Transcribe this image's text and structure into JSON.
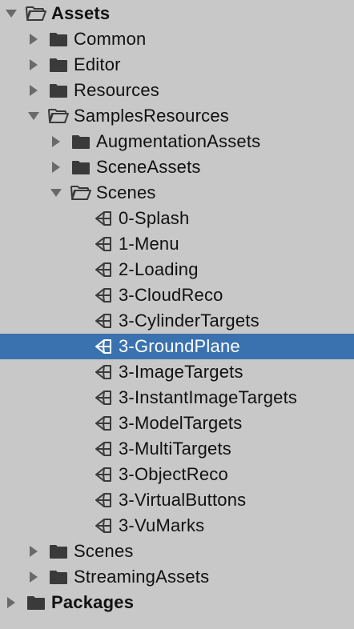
{
  "project_tree": {
    "colors": {
      "background": "#c8c8c8",
      "selection": "#3a72b0",
      "text": "#111111",
      "text_selected": "#ffffff",
      "icon": "#3a3a3a"
    },
    "items": [
      {
        "label": "Assets",
        "depth": 0,
        "type": "folder",
        "expanded": true,
        "bold": true
      },
      {
        "label": "Common",
        "depth": 1,
        "type": "folder",
        "expanded": false
      },
      {
        "label": "Editor",
        "depth": 1,
        "type": "folder",
        "expanded": false
      },
      {
        "label": "Resources",
        "depth": 1,
        "type": "folder",
        "expanded": false
      },
      {
        "label": "SamplesResources",
        "depth": 1,
        "type": "folder",
        "expanded": true
      },
      {
        "label": "AugmentationAssets",
        "depth": 2,
        "type": "folder",
        "expanded": false
      },
      {
        "label": "SceneAssets",
        "depth": 2,
        "type": "folder",
        "expanded": false
      },
      {
        "label": "Scenes",
        "depth": 2,
        "type": "folder",
        "expanded": true
      },
      {
        "label": "0-Splash",
        "depth": 3,
        "type": "scene"
      },
      {
        "label": "1-Menu",
        "depth": 3,
        "type": "scene"
      },
      {
        "label": "2-Loading",
        "depth": 3,
        "type": "scene"
      },
      {
        "label": "3-CloudReco",
        "depth": 3,
        "type": "scene"
      },
      {
        "label": "3-CylinderTargets",
        "depth": 3,
        "type": "scene"
      },
      {
        "label": "3-GroundPlane",
        "depth": 3,
        "type": "scene",
        "selected": true
      },
      {
        "label": "3-ImageTargets",
        "depth": 3,
        "type": "scene"
      },
      {
        "label": "3-InstantImageTargets",
        "depth": 3,
        "type": "scene"
      },
      {
        "label": "3-ModelTargets",
        "depth": 3,
        "type": "scene"
      },
      {
        "label": "3-MultiTargets",
        "depth": 3,
        "type": "scene"
      },
      {
        "label": "3-ObjectReco",
        "depth": 3,
        "type": "scene"
      },
      {
        "label": "3-VirtualButtons",
        "depth": 3,
        "type": "scene"
      },
      {
        "label": "3-VuMarks",
        "depth": 3,
        "type": "scene"
      },
      {
        "label": "Scenes",
        "depth": 1,
        "type": "folder",
        "expanded": false
      },
      {
        "label": "StreamingAssets",
        "depth": 1,
        "type": "folder",
        "expanded": false
      },
      {
        "label": "Packages",
        "depth": 0,
        "type": "folder",
        "expanded": false,
        "bold": true
      }
    ]
  }
}
